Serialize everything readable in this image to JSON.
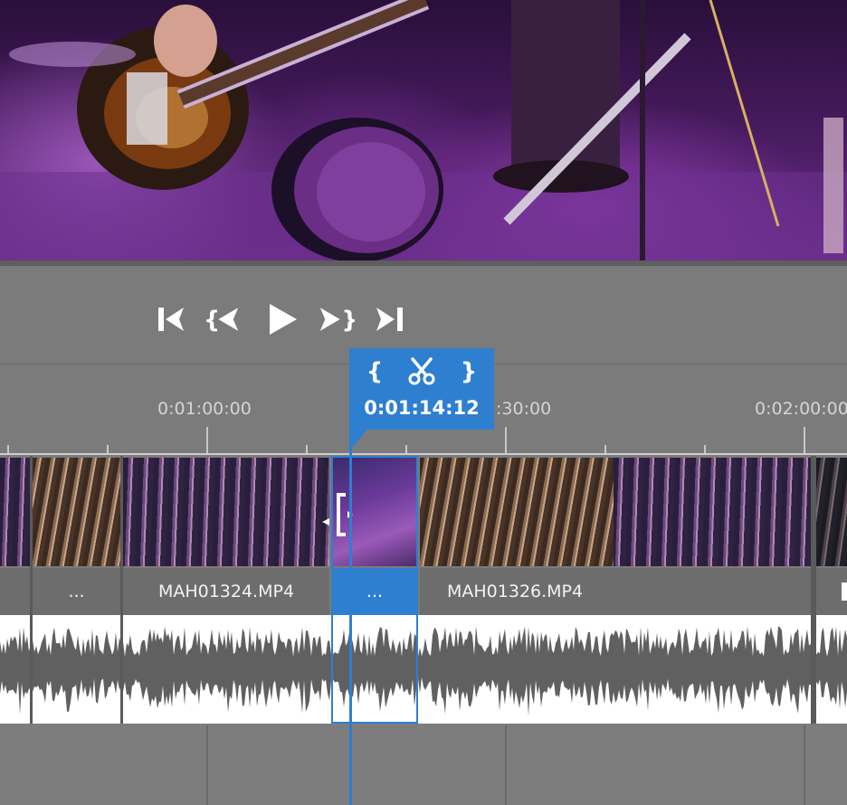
{
  "transport": {
    "buttons": [
      {
        "name": "go-to-start",
        "icon": "skip-to-start-icon"
      },
      {
        "name": "previous-edit",
        "icon": "previous-edit-icon"
      },
      {
        "name": "play",
        "icon": "play-icon"
      },
      {
        "name": "next-edit",
        "icon": "next-edit-icon"
      },
      {
        "name": "go-to-end",
        "icon": "skip-to-end-icon"
      }
    ]
  },
  "ruler": {
    "labels": [
      "0:01:00:00",
      ":30:00",
      "0:02:00:00"
    ]
  },
  "popup": {
    "mark_in_label": "{",
    "cut_icon": "scissors-icon",
    "mark_out_label": "}",
    "timecode": "0:01:14:12",
    "accent_color": "#2e7fd0"
  },
  "clips": [
    {
      "label": ""
    },
    {
      "label": "..."
    },
    {
      "label": "MAH01324.MP4"
    },
    {
      "label": "..."
    },
    {
      "label": "MAH01326.MP4"
    },
    {
      "label": ""
    }
  ]
}
